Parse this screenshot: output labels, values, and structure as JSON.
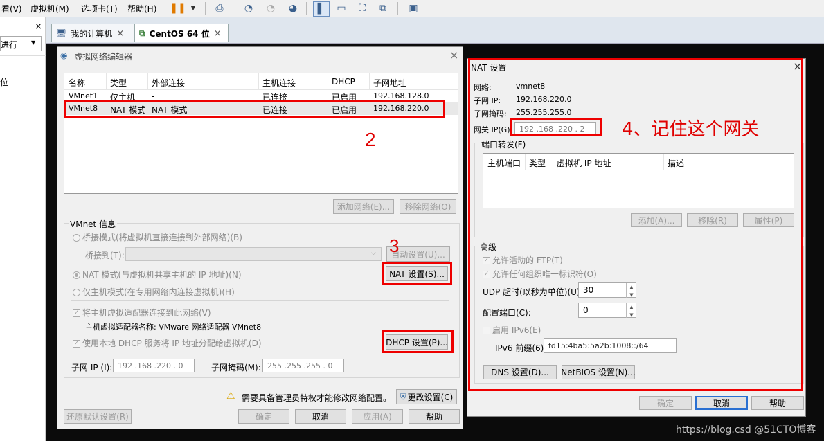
{
  "menubar": {
    "items": [
      "看(V)",
      "虚拟机(M)",
      "选项卡(T)",
      "帮助(H)"
    ]
  },
  "toolbar": {
    "icons": [
      "pause-icon",
      "dropdown-icon",
      "send-keys-icon",
      "snapshot-icon",
      "revert-snapshot-icon",
      "snapshot-manager-icon",
      "sidebar-icon",
      "console-icon",
      "fullscreen-icon",
      "unity-icon",
      "view-icon"
    ]
  },
  "left_pane": {
    "close": "×",
    "dropdown_text": "进行",
    "item": "位"
  },
  "tabs": [
    {
      "label": "我的计算机",
      "close": "×"
    },
    {
      "label": "CentOS 64 位",
      "close": "×"
    }
  ],
  "vne": {
    "title": "虚拟网络编辑器",
    "close": "×",
    "columns": [
      "名称",
      "类型",
      "外部连接",
      "主机连接",
      "DHCP",
      "子网地址"
    ],
    "rows": [
      [
        "VMnet1",
        "仅主机",
        "-",
        "已连接",
        "已启用",
        "192.168.128.0"
      ],
      [
        "VMnet8",
        "NAT 模式",
        "NAT 模式",
        "已连接",
        "已启用",
        "192.168.220.0"
      ]
    ],
    "add_network": "添加网络(E)...",
    "remove_network": "移除网络(O)",
    "info_group": "VMnet 信息",
    "bridge_mode": "桥接模式(将虚拟机直接连接到外部网络)(B)",
    "bridge_to": "桥接到(T):",
    "auto_settings": "自动设置(U)...",
    "nat_mode": "NAT 模式(与虚拟机共享主机的 IP 地址)(N)",
    "nat_settings": "NAT 设置(S)...",
    "host_only": "仅主机模式(在专用网络内连接虚拟机)(H)",
    "connect_adapter": "将主机虚拟适配器连接到此网络(V)",
    "adapter_name": "主机虚拟适配器名称: VMware 网络适配器 VMnet8",
    "use_dhcp": "使用本地 DHCP 服务将 IP 地址分配给虚拟机(D)",
    "dhcp_settings": "DHCP 设置(P)...",
    "subnet_ip_label": "子网 IP (I):",
    "subnet_ip": "192 .168 .220 .  0",
    "subnet_mask_label": "子网掩码(M):",
    "subnet_mask": "255 .255 .255 .  0",
    "admin_warning": "需要具备管理员特权才能修改网络配置。",
    "change_settings": "更改设置(C)",
    "restore_defaults": "还原默认设置(R)",
    "ok": "确定",
    "cancel": "取消",
    "apply": "应用(A)",
    "help": "帮助"
  },
  "nat": {
    "title": "NAT 设置",
    "close": "×",
    "network_label": "网络:",
    "network": "vmnet8",
    "subnet_ip_label": "子网 IP:",
    "subnet_ip": "192.168.220.0",
    "subnet_mask_label": "子网掩码:",
    "subnet_mask": "255.255.255.0",
    "gateway_label": "网关 IP(G):",
    "gateway": "192 .168 .220 .  2",
    "port_forward": "端口转发(F)",
    "pf_columns": [
      "主机端口",
      "类型",
      "虚拟机 IP 地址",
      "描述"
    ],
    "add": "添加(A)...",
    "remove": "移除(R)",
    "properties": "属性(P)",
    "advanced": "高级",
    "allow_ftp": "允许活动的 FTP(T)",
    "allow_oui": "允许任何组织唯一标识符(O)",
    "udp_timeout_label": "UDP 超时(以秒为单位)(U):",
    "udp_timeout": "30",
    "config_port_label": "配置端口(C):",
    "config_port": "0",
    "enable_ipv6": "启用 IPv6(E)",
    "ipv6_prefix_label": "IPv6 前缀(6):",
    "ipv6_prefix": "fd15:4ba5:5a2b:1008::/64",
    "dns_settings": "DNS 设置(D)...",
    "netbios_settings": "NetBIOS 设置(N)...",
    "ok": "确定",
    "cancel": "取消",
    "help": "帮助"
  },
  "annotations": {
    "step2": "2",
    "step3": "3",
    "step4": "4、记住这个网关",
    "color": "#e00000"
  },
  "watermark": "https://blog.csd @51CTO博客"
}
